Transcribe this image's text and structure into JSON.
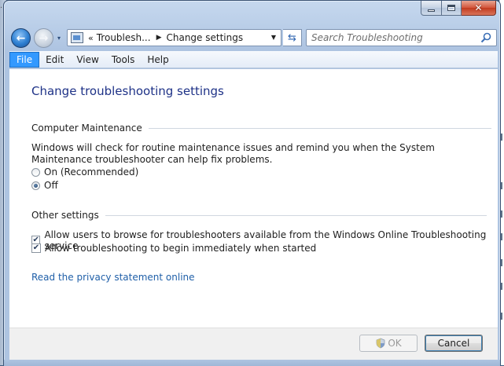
{
  "window": {
    "caption_close_glyph": "✕"
  },
  "background": {
    "left_text": "..."
  },
  "nav": {
    "back_glyph": "←",
    "forward_glyph": "→",
    "history_glyph": "▾",
    "address": {
      "separator": "«",
      "crumbs": [
        "Troublesh...",
        "Change settings"
      ],
      "crumb_arrow": "▶",
      "dropdown_glyph": "▼"
    },
    "refresh_glyph": "⇆",
    "search": {
      "placeholder": "Search Troubleshooting",
      "icon": "search-icon"
    }
  },
  "menu": {
    "items": [
      {
        "label": "File",
        "active": true
      },
      {
        "label": "Edit",
        "active": false
      },
      {
        "label": "View",
        "active": false
      },
      {
        "label": "Tools",
        "active": false
      },
      {
        "label": "Help",
        "active": false
      }
    ]
  },
  "content": {
    "title": "Change troubleshooting settings",
    "maintenance": {
      "header": "Computer Maintenance",
      "description": "Windows will check for routine maintenance issues and remind you when the System Maintenance troubleshooter can help fix problems.",
      "options": [
        {
          "label": "On (Recommended)",
          "checked": false
        },
        {
          "label": "Off",
          "checked": true
        }
      ]
    },
    "other": {
      "header": "Other settings",
      "options": [
        {
          "label": "Allow users to browse for troubleshooters available from the Windows Online Troubleshooting service",
          "checked": true
        },
        {
          "label": "Allow troubleshooting to begin immediately when started",
          "checked": true
        }
      ],
      "check_glyph": "✔"
    },
    "privacy_link": "Read the privacy statement online"
  },
  "buttons": {
    "ok": {
      "label": "OK",
      "enabled": false
    },
    "cancel": {
      "label": "Cancel",
      "enabled": true
    }
  },
  "colors": {
    "title_blue": "#1e3287",
    "link_blue": "#1f5fa8",
    "menu_highlight": "#3399ff",
    "frame": "#aec4e1"
  }
}
